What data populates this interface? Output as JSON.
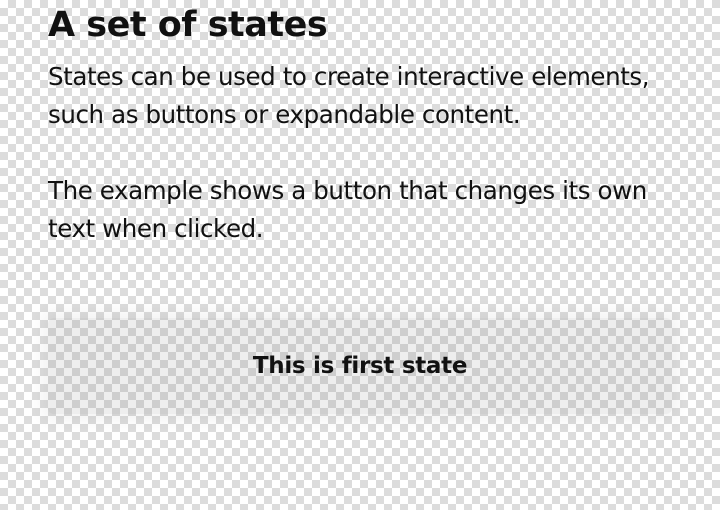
{
  "heading": "A set of states",
  "paragraphs": {
    "intro": "States can be used to create interactive elements, such as buttons or expandable content.",
    "example": "The example shows a button that changes its own text when clicked."
  },
  "state_button": {
    "label": "This is first state"
  }
}
